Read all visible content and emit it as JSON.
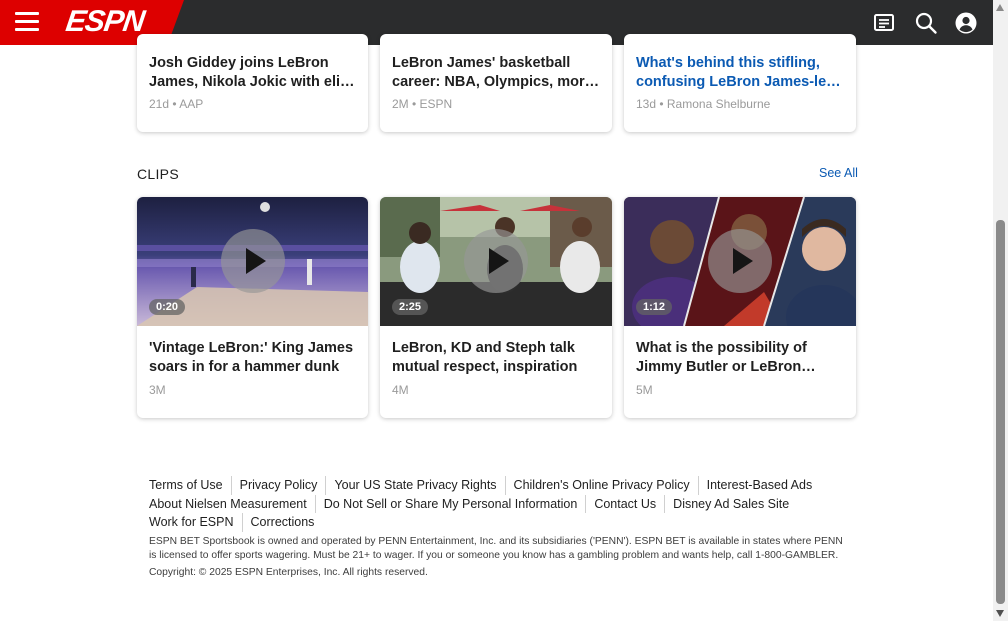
{
  "header": {
    "logo_text": "ESPN",
    "brand_color": "#dd0000",
    "icons": [
      "menu-icon",
      "news-feed-icon",
      "search-icon",
      "account-icon"
    ]
  },
  "top_cards": [
    {
      "title": "Josh Giddey joins LeBron James, Nikola Jokic with elite company",
      "meta": "21d • AAP"
    },
    {
      "title": "LeBron James' basketball career: NBA, Olympics, more stats",
      "meta": "2M • ESPN"
    },
    {
      "title": "What's behind this stifling, confusing LeBron James-led season",
      "meta": "13d • Ramona Shelburne"
    }
  ],
  "clips": {
    "label": "CLIPS",
    "see_all": "See All",
    "items": [
      {
        "title": "'Vintage LeBron:' King James soars in for a hammer dunk",
        "duration": "0:20",
        "meta": "3M"
      },
      {
        "title": "LeBron, KD and Steph talk mutual respect, inspiration",
        "duration": "2:25",
        "meta": "4M"
      },
      {
        "title": "What is the possibility of Jimmy Butler or LeBron James being traded?",
        "duration": "1:12",
        "meta": "5M"
      }
    ]
  },
  "footer": {
    "links": [
      "Terms of Use",
      "Privacy Policy",
      "Your US State Privacy Rights",
      "Children's Online Privacy Policy",
      "Interest-Based Ads",
      "About Nielsen Measurement",
      "Do Not Sell or Share My Personal Information",
      "Contact Us",
      "Disney Ad Sales Site",
      "Work for ESPN",
      "Corrections"
    ],
    "disclaimer": "ESPN BET Sportsbook is owned and operated by PENN Entertainment, Inc. and its subsidiaries ('PENN'). ESPN BET is available in states where PENN is licensed to offer sports wagering. Must be 21+ to wager. If you or someone you know has a gambling problem and wants help, call 1-800-GAMBLER.",
    "copyright": "Copyright: © 2025 ESPN Enterprises, Inc. All rights reserved."
  }
}
